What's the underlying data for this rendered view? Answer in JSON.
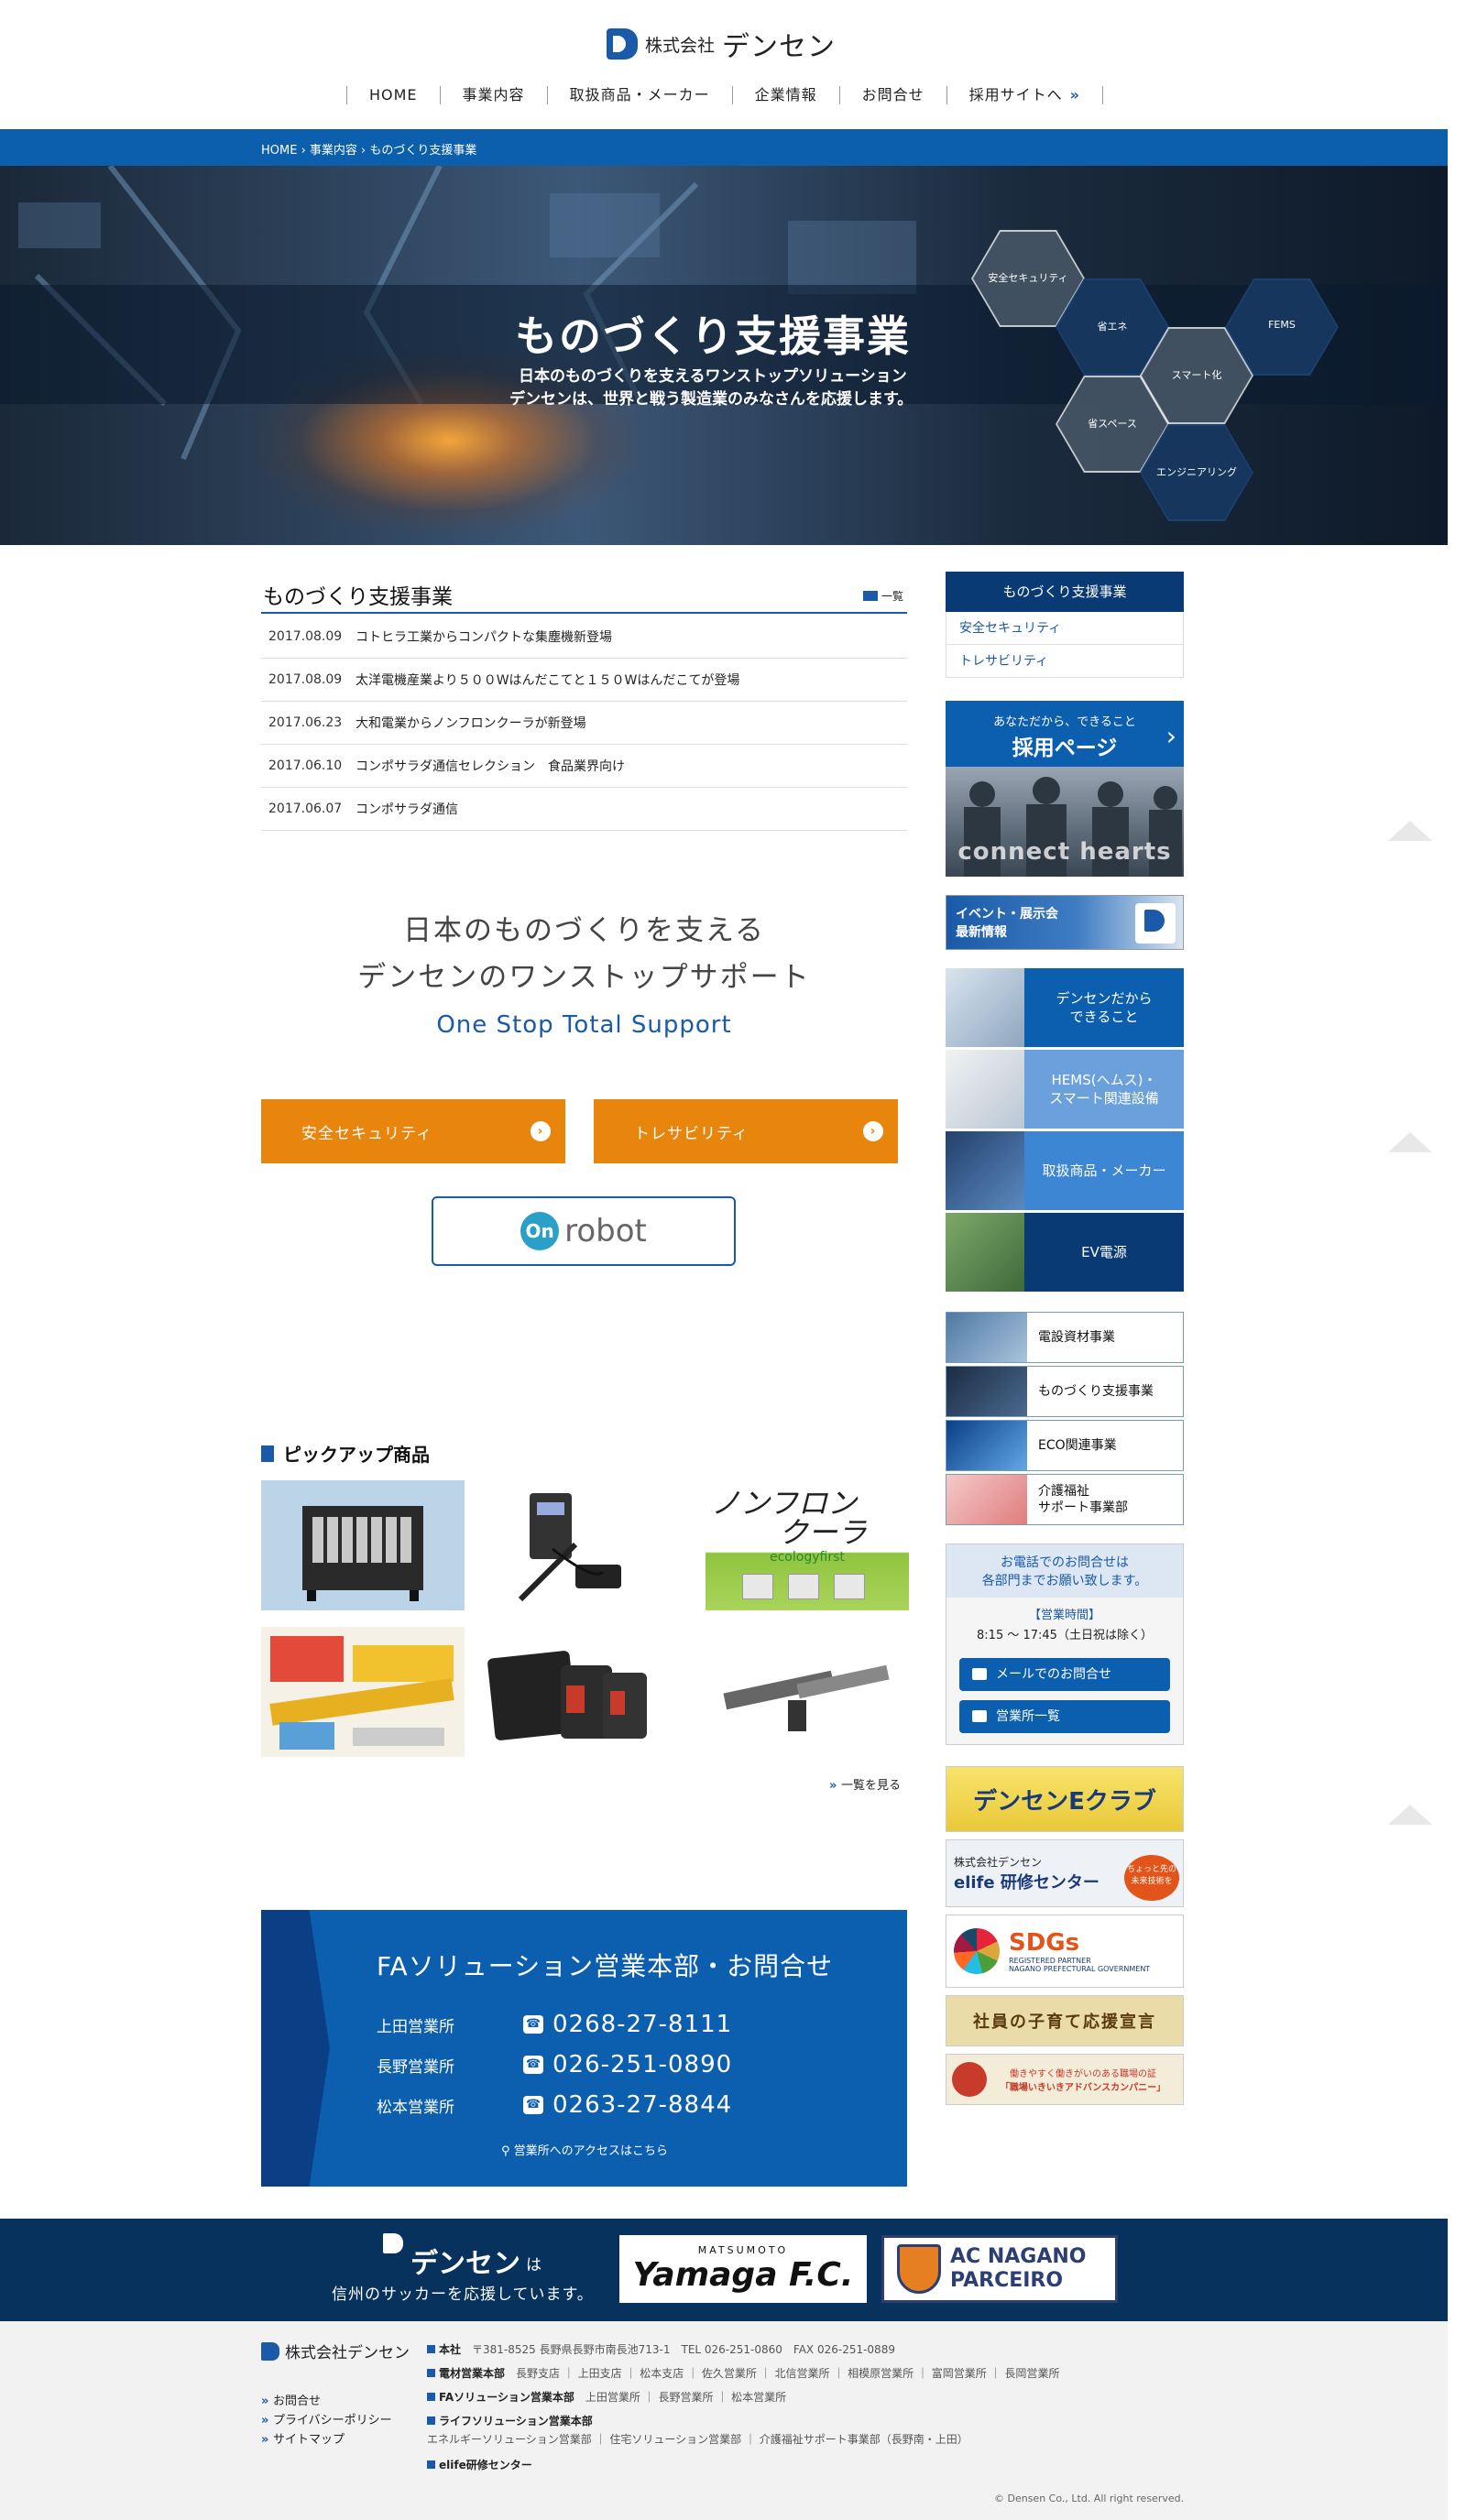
{
  "header": {
    "logo_company": "株式会社",
    "logo_brand": "デンセン",
    "nav": [
      {
        "label": "HOME"
      },
      {
        "label": "事業内容"
      },
      {
        "label": "取扱商品・メーカー"
      },
      {
        "label": "企業情報"
      },
      {
        "label": "お問合せ"
      },
      {
        "label": "採用サイトへ"
      }
    ]
  },
  "breadcrumb": "HOME › 事業内容 › ものづくり支援事業",
  "hero": {
    "title": "ものづくり支援事業",
    "sub1": "日本のものづくりを支えるワンストップソリューション",
    "sub2": "デンセンは、世界と戦う製造業のみなさんを応援します。",
    "hex": [
      "安全セキュリティ",
      "省エネ",
      "FEMS",
      "スマート化",
      "省スペース",
      "エンジニアリング"
    ]
  },
  "news": {
    "title": "ものづくり支援事業",
    "more": "一覧",
    "items": [
      {
        "date": "2017.08.09",
        "text": "コトヒラ工業からコンパクトな集塵機新登場"
      },
      {
        "date": "2017.08.09",
        "text": "太洋電機産業より５００Wはんだこてと１５０Wはんだこてが登場"
      },
      {
        "date": "2017.06.23",
        "text": "大和電業からノンフロンクーラが新登場"
      },
      {
        "date": "2017.06.10",
        "text": "コンポサラダ通信セレクション　食品業界向け"
      },
      {
        "date": "2017.06.07",
        "text": "コンポサラダ通信"
      }
    ]
  },
  "lead": {
    "line1": "日本のものづくりを支える",
    "line2": "デンセンのワンストップサポート",
    "line3": "One Stop Total Support"
  },
  "buttons": {
    "security": "安全セキュリティ",
    "trace": "トレサビリティ",
    "onrobot_on": "On",
    "onrobot_rest": "robot"
  },
  "pickup": {
    "title": "ピックアップ商品",
    "more": "一覧を見る",
    "img3_line1": "ノンフロン",
    "img3_line2": "クーラ",
    "img3_sub": "ecologyfirst"
  },
  "contact": {
    "title": "FAソリューション営業本部・お問合せ",
    "rows": [
      {
        "name": "上田営業所",
        "tel": "0268-27-8111"
      },
      {
        "name": "長野営業所",
        "tel": "026-251-0890"
      },
      {
        "name": "松本営業所",
        "tel": "0263-27-8844"
      }
    ],
    "access": "営業所へのアクセスはこちら"
  },
  "sidebar": {
    "head": "ものづくり支援事業",
    "links": [
      "安全セキュリティ",
      "トレサビリティ"
    ],
    "recruit_small": "あなただから、できること",
    "recruit_big": "採用ページ",
    "recruit_photo": "connect hearts",
    "event_l1": "イベント・展示会",
    "event_l2": "最新情報",
    "event_mark": "densen",
    "big": [
      "デンセンだから\nできること",
      "HEMS(ヘムス)・\nスマート関連設備",
      "取扱商品・メーカー",
      "EV電源"
    ],
    "small": [
      "電設資材事業",
      "ものづくり支援事業",
      "ECO関連事業",
      "介護福祉\nサポート事業部"
    ],
    "tel_head1": "お電話でのお問合せは",
    "tel_head2": "各部門までお願い致します。",
    "hours_label": "【営業時間】",
    "hours": "8:15 〜 17:45（土日祝は除く）",
    "mail_btn": "メールでのお問合せ",
    "office_btn": "営業所一覧",
    "banner1": "デンセンEクラブ",
    "banner2a": "株式会社デンセン",
    "banner2b": "elife 研修センター",
    "banner2c": "ちょっと先の未来技術を",
    "banner3": "SDGs",
    "banner3_sub1": "REGISTERED PARTNER",
    "banner3_sub2": "NAGANO PREFECTURAL GOVERNMENT",
    "banner4": "社員の子育て応援宣言",
    "banner5a": "働きやすく働きがいのある職場の証",
    "banner5b": "「職場いきいきアドバンスカンパニー」"
  },
  "soccer": {
    "brand": "デンセン",
    "wa": "は",
    "msg": "信州のサッカーを応援しています。",
    "yamaga_top": "MATSUMOTO",
    "yamaga": "Yamaga F.C.",
    "parceiro1": "AC NAGANO",
    "parceiro2": "PARCEIRO"
  },
  "footer": {
    "logo_company": "株式会社",
    "logo_brand": "デンセン",
    "links": [
      "お問合せ",
      "プライバシーポリシー",
      "サイトマップ"
    ],
    "hq_label": "本社",
    "hq": "〒381-8525 長野県長野市南長池713-1　TEL 026-251-0860　FAX 026-251-0889",
    "denzai_label": "電材営業本部",
    "denzai": "長野支店 ｜ 上田支店 ｜ 松本支店 ｜ 佐久営業所 ｜ 北信営業所 ｜ 相模原営業所 ｜ 富岡営業所 ｜ 長岡営業所",
    "fa_label": "FAソリューション営業本部",
    "fa": "上田営業所 ｜ 長野営業所 ｜ 松本営業所",
    "life_label": "ライフソリューション営業本部",
    "life": "エネルギーソリューション営業部 ｜ 住宅ソリューション営業部 ｜ 介護福祉サポート事業部（長野南・上田）",
    "elife": "elife研修センター",
    "copy": "© Densen Co., Ltd. All right reserved."
  },
  "colors": {
    "brand": "#1a5aa8",
    "orange": "#e8850c",
    "navy": "#0a3a74"
  }
}
